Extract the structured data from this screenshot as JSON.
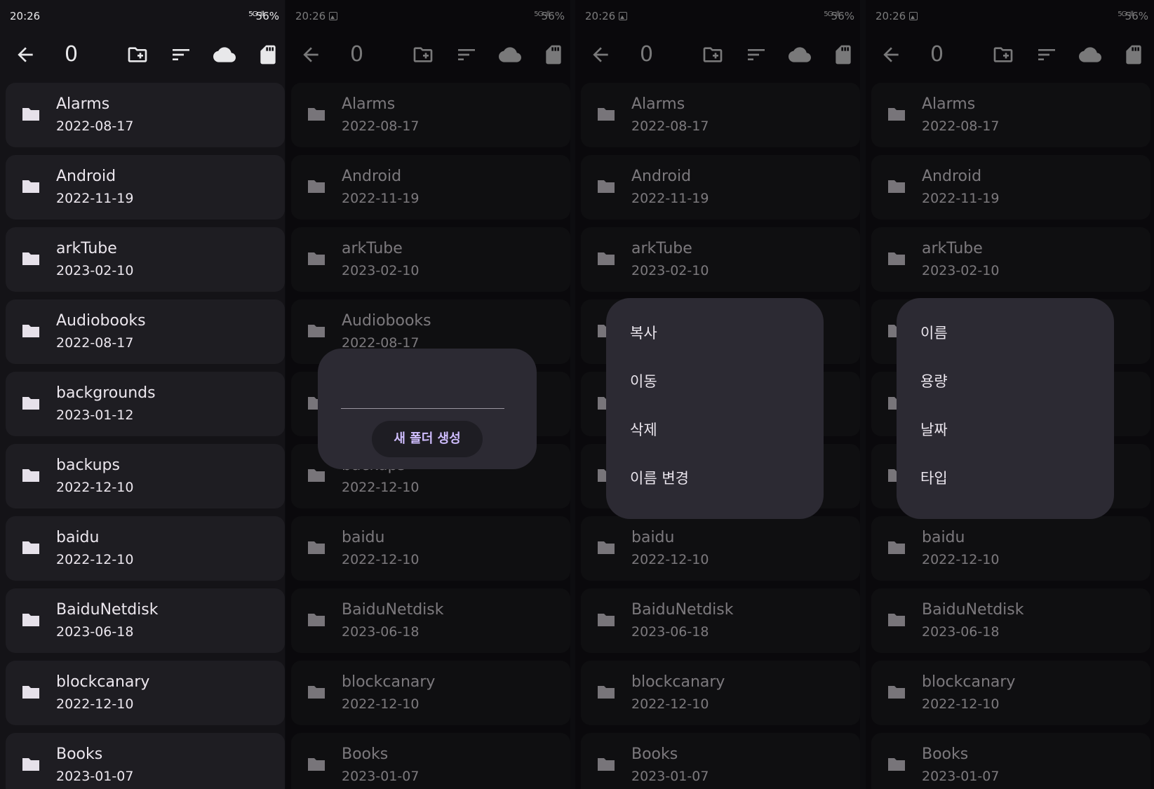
{
  "status": {
    "time": "20:26",
    "network": "5G .ıll",
    "battery": "56%"
  },
  "toolbar": {
    "count": "0"
  },
  "folders": [
    {
      "name": "Alarms",
      "date": "2022-08-17"
    },
    {
      "name": "Android",
      "date": "2022-11-19"
    },
    {
      "name": "arkTube",
      "date": "2023-02-10"
    },
    {
      "name": "Audiobooks",
      "date": "2022-08-17"
    },
    {
      "name": "backgrounds",
      "date": "2023-01-12"
    },
    {
      "name": "backups",
      "date": "2022-12-10"
    },
    {
      "name": "baidu",
      "date": "2022-12-10"
    },
    {
      "name": "BaiduNetdisk",
      "date": "2023-06-18"
    },
    {
      "name": "blockcanary",
      "date": "2022-12-10"
    },
    {
      "name": "Books",
      "date": "2023-01-07"
    }
  ],
  "new_folder_dialog": {
    "input_value": "",
    "create_label": "새 폴더 생성"
  },
  "file_menu": {
    "items": [
      "복사",
      "이동",
      "삭제",
      "이름 변경"
    ]
  },
  "sort_menu": {
    "items": [
      "이름",
      "용량",
      "날짜",
      "타입"
    ]
  },
  "colors": {
    "background": "#141317",
    "card": "#1e1d22",
    "dialog": "#2c2a33",
    "accent": "#cfbdfe"
  },
  "icons": [
    "back-arrow-icon",
    "create-folder-icon",
    "sort-icon",
    "cloud-icon",
    "sd-card-icon",
    "folder-icon",
    "image-notification-icon"
  ]
}
